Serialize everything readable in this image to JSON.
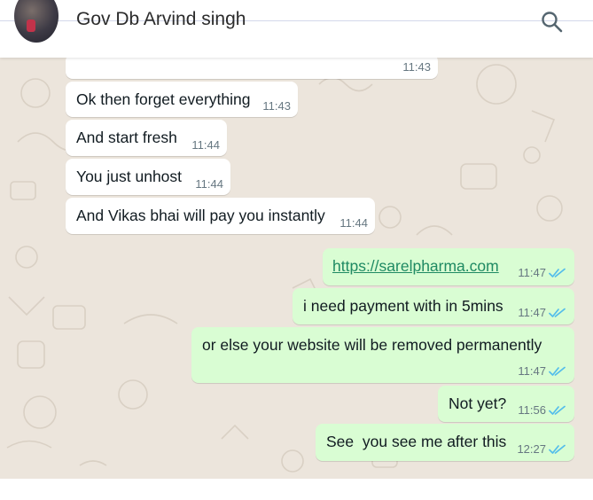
{
  "contact": {
    "name": "Gov Db Arvind singh"
  },
  "messages": [
    {
      "direction": "in",
      "text": "",
      "time": "11:43"
    },
    {
      "direction": "in",
      "text": "Ok then forget everything",
      "time": "11:43"
    },
    {
      "direction": "in",
      "text": "And start fresh",
      "time": "11:44"
    },
    {
      "direction": "in",
      "text": "You just unhost",
      "time": "11:44"
    },
    {
      "direction": "in",
      "text": "And Vikas bhai will pay you instantly",
      "time": "11:44"
    },
    {
      "direction": "out",
      "text": "https://sarelpharma.com",
      "time": "11:47",
      "is_link": true,
      "read": true
    },
    {
      "direction": "out",
      "text": "i need payment with in 5mins",
      "time": "11:47",
      "read": true
    },
    {
      "direction": "out",
      "text": "or else your website will be removed permanently",
      "time": "11:47",
      "read": true
    },
    {
      "direction": "out",
      "text": "Not yet?",
      "time": "11:56",
      "read": true
    },
    {
      "direction": "out",
      "text": "See  you see me after this",
      "time": "12:27",
      "read": true
    }
  ],
  "colors": {
    "incoming_bubble": "#ffffff",
    "outgoing_bubble": "#d9fdd3",
    "chat_background": "#ece5dc",
    "read_ticks": "#53bdeb",
    "link": "#1f8a63"
  },
  "icons": {
    "search": "search-icon",
    "read_receipt": "double-check-icon"
  }
}
